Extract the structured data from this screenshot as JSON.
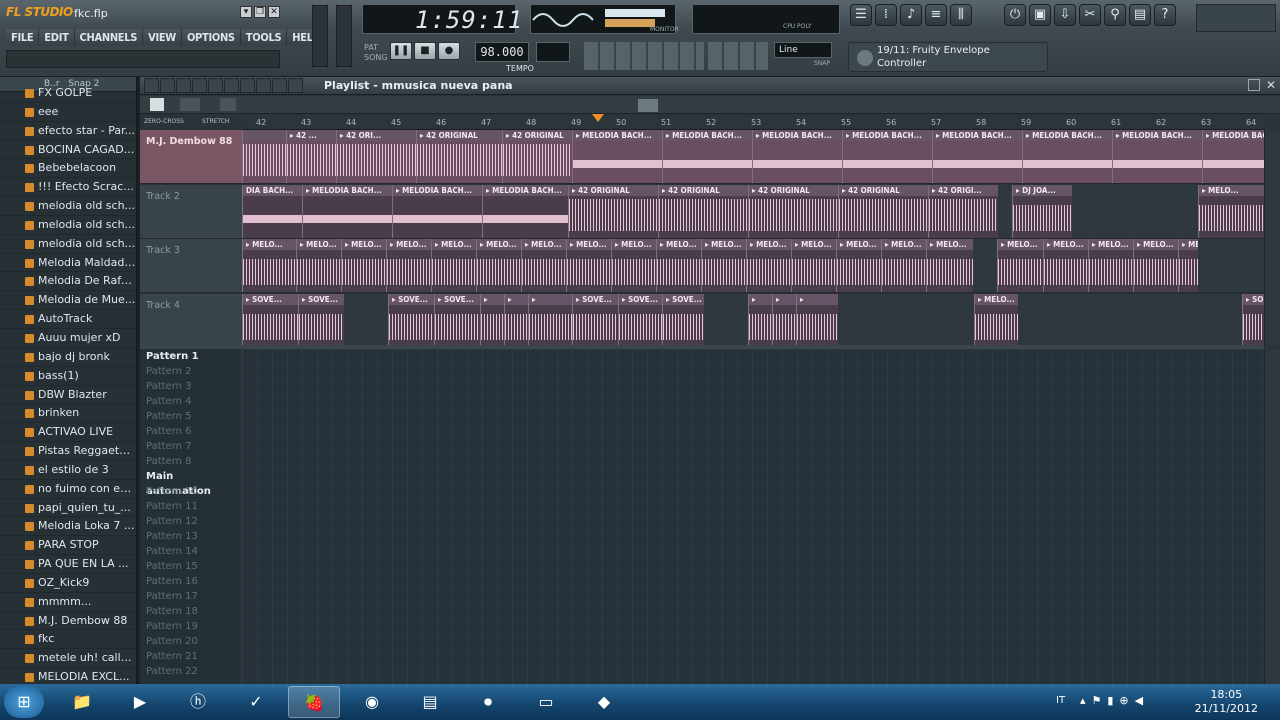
{
  "app": {
    "logo": "FL STUDIO",
    "file_name": "fkc.flp"
  },
  "menu": [
    "FILE",
    "EDIT",
    "CHANNELS",
    "VIEW",
    "OPTIONS",
    "TOOLS",
    "HELP"
  ],
  "transport": {
    "time": "1:59:11",
    "tempo": "98.000",
    "tempo_label": "TEMPO",
    "pat_label": "PAT",
    "song_label": "SONG",
    "snap_mode": "Line",
    "snap_label": "SNAP",
    "cpu_label": "CPU",
    "poly_label": "POLY",
    "monitor_label": "MONITOR"
  },
  "hint": {
    "line1": "19/11: Fruity Envelope",
    "line2": "Controller"
  },
  "browser": {
    "snap": "Snap 2",
    "header": "B..r",
    "items": [
      "FX GOLPE",
      "eee",
      "efecto star - Par...",
      "BOCINA CAGAD...",
      "Bebebelacoon",
      "!!! Efecto Scrac...",
      "melodia old sch...",
      "melodia old sch...",
      "melodia old sch...",
      "Melodia Maldades",
      "Melodia De Rafy...",
      "Melodia de Mue...",
      "AutoTrack",
      "Auuu mujer xD",
      "bajo dj bronk",
      "bass(1)",
      "DBW Blazter",
      "brinken",
      "ACTIVAO LIVE",
      "Pistas Reggaeto...",
      "el estilo de 3",
      "no fuimo con es...",
      "papi_quien_tu_...",
      "Melodia Loka 7 ...",
      "PARA STOP",
      "PA QUE EN LA ...",
      "OZ_Kick9",
      "mmmm...",
      "M.J. Dembow 88",
      "fkc",
      "metele uh! calle...",
      "MELODIA EXCL..."
    ]
  },
  "playlist": {
    "title": "Playlist - mmusica nueva pana",
    "zero_cross": "ZERO-CROSS",
    "stretch": "STRETCH",
    "ruler": [
      "42",
      "43",
      "44",
      "45",
      "46",
      "47",
      "48",
      "49",
      "50",
      "51",
      "52",
      "53",
      "54",
      "55",
      "56",
      "57",
      "58",
      "59",
      "60",
      "61",
      "62",
      "63",
      "64"
    ],
    "tracks": [
      {
        "name": "M.J. Dembow 88",
        "clips": [
          {
            "l": 0,
            "w": 44,
            "t": ""
          },
          {
            "l": 44,
            "w": 50,
            "t": "▸ 42 ..."
          },
          {
            "l": 94,
            "w": 80,
            "t": "▸ 42 ORI..."
          },
          {
            "l": 174,
            "w": 86,
            "t": "▸ 42 ORIGINAL"
          },
          {
            "l": 260,
            "w": 70,
            "t": "▸ 42 ORIGINAL"
          },
          {
            "l": 330,
            "w": 90,
            "t": "▸ MELODIA BACH..."
          },
          {
            "l": 420,
            "w": 90,
            "t": "▸ MELODIA BACH..."
          },
          {
            "l": 510,
            "w": 90,
            "t": "▸ MELODIA BACH..."
          },
          {
            "l": 600,
            "w": 90,
            "t": "▸ MELODIA BACH..."
          },
          {
            "l": 690,
            "w": 90,
            "t": "▸ MELODIA BACH..."
          },
          {
            "l": 780,
            "w": 90,
            "t": "▸ MELODIA BACH..."
          },
          {
            "l": 870,
            "w": 90,
            "t": "▸ MELODIA BACH..."
          },
          {
            "l": 960,
            "w": 62,
            "t": "▸ MELODIA BACH..."
          }
        ]
      },
      {
        "name": "Track 2",
        "clips": [
          {
            "l": 0,
            "w": 60,
            "t": "DIA BACH..."
          },
          {
            "l": 60,
            "w": 90,
            "t": "▸ MELODIA BACH..."
          },
          {
            "l": 150,
            "w": 90,
            "t": "▸ MELODIA BACH..."
          },
          {
            "l": 240,
            "w": 86,
            "t": "▸ MELODIA BACH..."
          },
          {
            "l": 326,
            "w": 90,
            "t": "▸ 42 ORIGINAL"
          },
          {
            "l": 416,
            "w": 90,
            "t": "▸ 42 ORIGINAL"
          },
          {
            "l": 506,
            "w": 90,
            "t": "▸ 42 ORIGINAL"
          },
          {
            "l": 596,
            "w": 90,
            "t": "▸ 42 ORIGINAL"
          },
          {
            "l": 686,
            "w": 70,
            "t": "▸ 42 ORIGI..."
          },
          {
            "l": 770,
            "w": 60,
            "t": "▸ DJ JOA..."
          },
          {
            "l": 956,
            "w": 66,
            "t": "▸ MELO..."
          }
        ]
      },
      {
        "name": "Track 3",
        "clips": [
          {
            "l": 0,
            "w": 54,
            "t": "▸ MELO..."
          },
          {
            "l": 54,
            "w": 45,
            "t": "▸ MELO..."
          },
          {
            "l": 99,
            "w": 45,
            "t": "▸ MELO..."
          },
          {
            "l": 144,
            "w": 45,
            "t": "▸ MELO..."
          },
          {
            "l": 189,
            "w": 45,
            "t": "▸ MELO..."
          },
          {
            "l": 234,
            "w": 45,
            "t": "▸ MELO..."
          },
          {
            "l": 279,
            "w": 45,
            "t": "▸ MELO..."
          },
          {
            "l": 324,
            "w": 45,
            "t": "▸ MELO..."
          },
          {
            "l": 369,
            "w": 45,
            "t": "▸ MELO..."
          },
          {
            "l": 414,
            "w": 45,
            "t": "▸ MELO..."
          },
          {
            "l": 459,
            "w": 45,
            "t": "▸ MELO..."
          },
          {
            "l": 504,
            "w": 45,
            "t": "▸ MELO..."
          },
          {
            "l": 549,
            "w": 45,
            "t": "▸ MELO..."
          },
          {
            "l": 594,
            "w": 45,
            "t": "▸ MELO..."
          },
          {
            "l": 639,
            "w": 45,
            "t": "▸ MELO..."
          },
          {
            "l": 684,
            "w": 47,
            "t": "▸ MELO..."
          },
          {
            "l": 755,
            "w": 46,
            "t": "▸ MELO..."
          },
          {
            "l": 801,
            "w": 45,
            "t": "▸ MELO..."
          },
          {
            "l": 846,
            "w": 45,
            "t": "▸ MELO..."
          },
          {
            "l": 891,
            "w": 45,
            "t": "▸ MELO..."
          },
          {
            "l": 936,
            "w": 20,
            "t": "▸ MELO..."
          }
        ]
      },
      {
        "name": "Track 4",
        "clips": [
          {
            "l": 0,
            "w": 56,
            "t": "▸ SOVE..."
          },
          {
            "l": 56,
            "w": 46,
            "t": "▸ SOVE..."
          },
          {
            "l": 146,
            "w": 46,
            "t": "▸ SOVE..."
          },
          {
            "l": 192,
            "w": 46,
            "t": "▸ SOVE..."
          },
          {
            "l": 238,
            "w": 24,
            "t": "▸"
          },
          {
            "l": 262,
            "w": 24,
            "t": "▸"
          },
          {
            "l": 286,
            "w": 44,
            "t": "▸"
          },
          {
            "l": 330,
            "w": 46,
            "t": "▸ SOVE..."
          },
          {
            "l": 376,
            "w": 44,
            "t": "▸ SOVE..."
          },
          {
            "l": 420,
            "w": 42,
            "t": "▸ SOVE..."
          },
          {
            "l": 506,
            "w": 24,
            "t": "▸"
          },
          {
            "l": 530,
            "w": 24,
            "t": "▸"
          },
          {
            "l": 554,
            "w": 42,
            "t": "▸"
          },
          {
            "l": 732,
            "w": 44,
            "t": "▸ MELO..."
          },
          {
            "l": 1000,
            "w": 22,
            "t": "▸ SO"
          }
        ]
      }
    ],
    "patterns": [
      "Pattern 1",
      "Pattern 2",
      "Pattern 3",
      "Pattern 4",
      "Pattern 5",
      "Pattern 6",
      "Pattern 7",
      "Pattern 8",
      "Main automation",
      "Pattern 10",
      "Pattern 11",
      "Pattern 12",
      "Pattern 13",
      "Pattern 14",
      "Pattern 15",
      "Pattern 16",
      "Pattern 17",
      "Pattern 18",
      "Pattern 19",
      "Pattern 20",
      "Pattern 21",
      "Pattern 22"
    ]
  },
  "taskbar": {
    "lang": "IT",
    "time": "18:05",
    "date": "21/11/2012"
  }
}
